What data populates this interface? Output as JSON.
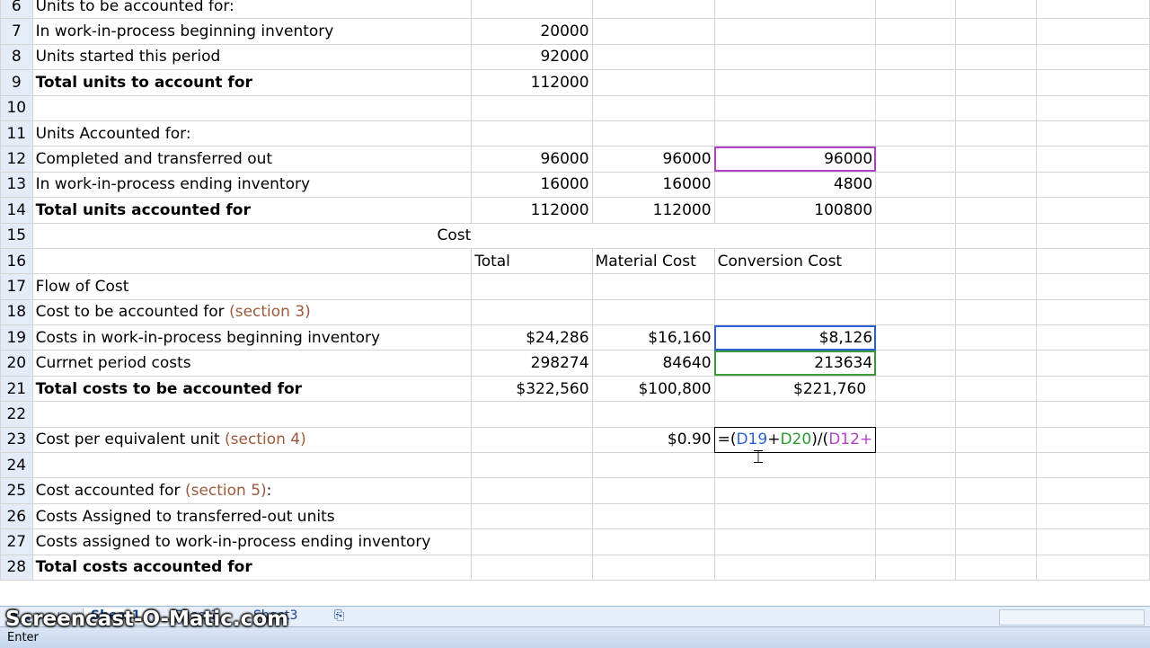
{
  "rows": [
    {
      "n": "6",
      "a": "Units to be accounted for:",
      "b": "",
      "c": "",
      "d": ""
    },
    {
      "n": "7",
      "a": "In work-in-process beginning inventory",
      "b": "20000",
      "c": "",
      "d": ""
    },
    {
      "n": "8",
      "a": "Units started this period",
      "b": "92000",
      "c": "",
      "d": ""
    },
    {
      "n": "9",
      "a": "Total units to account for",
      "b": "112000",
      "c": "",
      "d": ""
    },
    {
      "n": "10",
      "a": "",
      "b": "",
      "c": "",
      "d": ""
    },
    {
      "n": "11",
      "a": "Units Accounted for:",
      "b": "",
      "c": "",
      "d": ""
    },
    {
      "n": "12",
      "a": "Completed and transferred out",
      "b": "96000",
      "c": "96000",
      "d": "96000"
    },
    {
      "n": "13",
      "a": "In work-in-process ending inventory",
      "b": "16000",
      "c": "16000",
      "d": "4800"
    },
    {
      "n": "14",
      "a": "Total units accounted for",
      "b": "112000",
      "c": "112000",
      "d": "100800"
    },
    {
      "n": "15",
      "merged": "Cost"
    },
    {
      "n": "16",
      "a": "",
      "b": "Total",
      "c": "Material Cost",
      "d": "Conversion Cost"
    },
    {
      "n": "17",
      "a": "Flow of Cost",
      "b": "",
      "c": "",
      "d": ""
    },
    {
      "n": "18",
      "a": "Cost to be accounted for ",
      "note": "(section 3)",
      "b": "",
      "c": "",
      "d": ""
    },
    {
      "n": "19",
      "a": "Costs in work-in-process beginning inventory",
      "b": "$24,286",
      "c": "$16,160",
      "d": "$8,126"
    },
    {
      "n": "20",
      "a": "Currnet period costs",
      "b": "298274",
      "c": "84640",
      "d": "213634"
    },
    {
      "n": "21",
      "a": "Total costs to be accounted for",
      "b": "$322,560",
      "c": "$100,800",
      "d": "$221,760"
    },
    {
      "n": "22",
      "a": "",
      "b": "",
      "c": "",
      "d": ""
    },
    {
      "n": "23",
      "a": "Cost per equivalent unit ",
      "note": "(section 4)",
      "b": "",
      "c": "$0.90",
      "d": ""
    },
    {
      "n": "24",
      "a": "",
      "b": "",
      "c": "",
      "d": ""
    },
    {
      "n": "25",
      "a": "Cost accounted for ",
      "note": "(section 5)",
      "tail": ":",
      "b": "",
      "c": "",
      "d": ""
    },
    {
      "n": "26",
      "a": "Costs Assigned to transferred-out units",
      "b": "",
      "c": "",
      "d": ""
    },
    {
      "n": "27",
      "a": "Costs assigned to work-in-process ending inventory",
      "b": "",
      "c": "",
      "d": ""
    },
    {
      "n": "28",
      "a": "Total costs accounted for",
      "b": "",
      "c": "",
      "d": ""
    }
  ],
  "formula": {
    "p0": "=(",
    "r1": "D19",
    "p1": "+",
    "r2": "D20",
    "p2": ")/(",
    "r3": "D12",
    "p3": "+"
  },
  "tabs": {
    "sheet1": "Sheet1",
    "sheet2": "Sheet2",
    "sheet3": "Sheet3"
  },
  "status": {
    "mode": "Enter"
  },
  "watermark": "Screencast-O-Matic.com",
  "colors": {
    "purple": "#b040c8",
    "blue": "#2b5fd9",
    "green": "#3a9a3a",
    "header": "#e4ecf7"
  }
}
